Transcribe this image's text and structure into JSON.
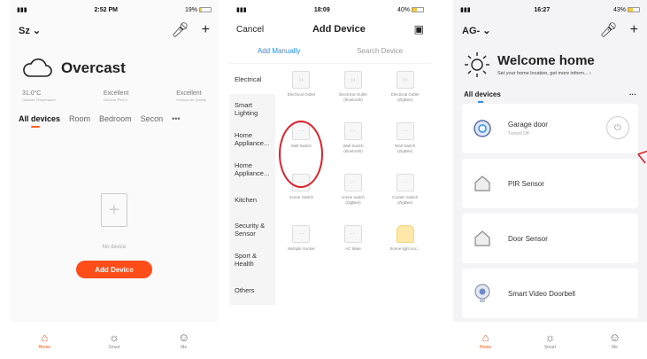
{
  "colors": {
    "accent": "#ff4d1a",
    "blue": "#2b8ef0",
    "red_circle": "#e0202a"
  },
  "panel1": {
    "status": {
      "signal": "▮▮▮",
      "time": "2:52 PM",
      "battery": "19%",
      "battery_level": 0.19
    },
    "home_name": "Sz ⌄",
    "weather": {
      "condition": "Overcast"
    },
    "stats": [
      {
        "value": "31.0°C",
        "label": "Outdoor Temperature"
      },
      {
        "value": "Excellent",
        "label": "Outdoor PM2.5"
      },
      {
        "value": "Excellent",
        "label": "Outdoor Air Quality"
      }
    ],
    "rooms": [
      "All devices",
      "Room",
      "Bedroom",
      "Secon",
      "•••"
    ],
    "empty_text": "No device",
    "add_button": "Add Device",
    "tabs": [
      {
        "label": "Home",
        "icon": "home-icon"
      },
      {
        "label": "Smart",
        "icon": "sun-icon"
      },
      {
        "label": "Me",
        "icon": "profile-icon"
      }
    ]
  },
  "panel2": {
    "status": {
      "time": "18:09",
      "battery": "40%",
      "battery_level": 0.4
    },
    "nav": {
      "cancel": "Cancel",
      "title": "Add Device"
    },
    "segments": [
      "Add Manually",
      "Search Device"
    ],
    "categories": [
      "Electrical",
      "Smart Lighting",
      "Home Appliance...",
      "Home Appliance...",
      "Kitchen",
      "Security & Sensor",
      "Sport & Health",
      "Others"
    ],
    "devices": [
      {
        "name": "Electrical Outlet",
        "sub": ""
      },
      {
        "name": "Electrical Outlet",
        "sub": "(bluetooth)"
      },
      {
        "name": "Electrical Outlet",
        "sub": "(ZigBee)"
      },
      {
        "name": "Wall Switch",
        "sub": ""
      },
      {
        "name": "Wall Switch",
        "sub": "(bluetooth)"
      },
      {
        "name": "Wall Switch",
        "sub": "(ZigBee)"
      },
      {
        "name": "Scene Switch",
        "sub": ""
      },
      {
        "name": "scene switch",
        "sub": "(ZigBee)"
      },
      {
        "name": "Curtain Switch",
        "sub": "(ZigBee)"
      },
      {
        "name": "Multiple Socket",
        "sub": ""
      },
      {
        "name": "AC Mate",
        "sub": ""
      },
      {
        "name": "Scene light soc...",
        "sub": ""
      }
    ]
  },
  "panel3": {
    "status": {
      "time": "16:27",
      "battery": "43%",
      "battery_level": 0.43
    },
    "home_name": "AG- ⌄",
    "welcome": {
      "title": "Welcome home",
      "subtitle": "Set your home location, get more inform... ›"
    },
    "section": "All devices",
    "devices": [
      {
        "name": "Garage door",
        "sub": "Turned Off",
        "icon": "garage-door-icon"
      },
      {
        "name": "PIR Sensor",
        "sub": "",
        "icon": "house-icon"
      },
      {
        "name": "Door Sensor",
        "sub": "",
        "icon": "house-icon"
      },
      {
        "name": "Smart Video Doorbell",
        "sub": "",
        "icon": "doorbell-icon"
      }
    ],
    "tabs": [
      {
        "label": "Home",
        "icon": "home-icon"
      },
      {
        "label": "Smart",
        "icon": "sun-icon"
      },
      {
        "label": "Me",
        "icon": "profile-icon"
      }
    ]
  }
}
